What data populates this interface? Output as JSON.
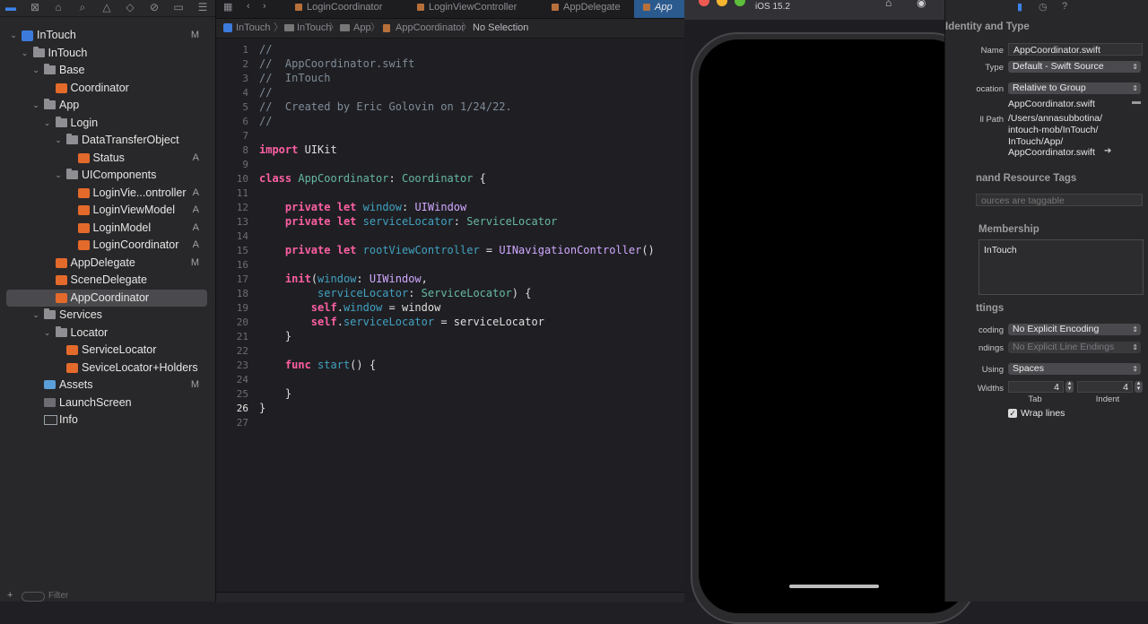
{
  "navigator": {
    "tree": [
      {
        "label": "InTouch",
        "badge": "M",
        "icon": "project-icon",
        "chev": "open"
      },
      {
        "label": "InTouch",
        "badge": "",
        "icon": "folder-icon",
        "chev": "open"
      },
      {
        "label": "Base",
        "badge": "",
        "icon": "folder-icon",
        "chev": "open"
      },
      {
        "label": "Coordinator",
        "badge": "",
        "icon": "swift-file-icon",
        "chev": ""
      },
      {
        "label": "App",
        "badge": "",
        "icon": "folder-icon",
        "chev": "open"
      },
      {
        "label": "Login",
        "badge": "",
        "icon": "folder-icon",
        "chev": "open"
      },
      {
        "label": "DataTransferObject",
        "badge": "",
        "icon": "folder-icon",
        "chev": "open"
      },
      {
        "label": "Status",
        "badge": "A",
        "icon": "swift-file-icon",
        "chev": ""
      },
      {
        "label": "UIComponents",
        "badge": "",
        "icon": "folder-icon",
        "chev": "open"
      },
      {
        "label": "LoginVie...ontroller",
        "badge": "A",
        "icon": "swift-file-icon",
        "chev": ""
      },
      {
        "label": "LoginViewModel",
        "badge": "A",
        "icon": "swift-file-icon",
        "chev": ""
      },
      {
        "label": "LoginModel",
        "badge": "A",
        "icon": "swift-file-icon",
        "chev": ""
      },
      {
        "label": "LoginCoordinator",
        "badge": "A",
        "icon": "swift-file-icon",
        "chev": ""
      },
      {
        "label": "AppDelegate",
        "badge": "M",
        "icon": "swift-file-icon",
        "chev": ""
      },
      {
        "label": "SceneDelegate",
        "badge": "",
        "icon": "swift-file-icon",
        "chev": ""
      },
      {
        "label": "AppCoordinator",
        "badge": "",
        "icon": "swift-file-icon",
        "chev": "",
        "selected": true
      },
      {
        "label": "Services",
        "badge": "",
        "icon": "folder-icon",
        "chev": "open"
      },
      {
        "label": "Locator",
        "badge": "",
        "icon": "folder-icon",
        "chev": "open"
      },
      {
        "label": "ServiceLocator",
        "badge": "",
        "icon": "swift-file-icon",
        "chev": ""
      },
      {
        "label": "SeviceLocator+Holders",
        "badge": "",
        "icon": "swift-file-icon",
        "chev": ""
      },
      {
        "label": "Assets",
        "badge": "M",
        "icon": "asset-catalog-icon",
        "chev": ""
      },
      {
        "label": "LaunchScreen",
        "badge": "",
        "icon": "storyboard-icon",
        "chev": ""
      },
      {
        "label": "Info",
        "badge": "",
        "icon": "plist-icon",
        "chev": ""
      }
    ],
    "filter_placeholder": "Filter"
  },
  "tabs": [
    "LoginCoordinator",
    "LoginViewController",
    "AppDelegate",
    "App"
  ],
  "jumpbar": [
    "InTouch",
    "InTouch",
    "App",
    "AppCoordinator",
    "No Selection"
  ],
  "editor": {
    "current_line": 26,
    "lines": [
      [
        [
          "cmt",
          "//"
        ]
      ],
      [
        [
          "cmt",
          "//  AppCoordinator.swift"
        ]
      ],
      [
        [
          "cmt",
          "//  InTouch"
        ]
      ],
      [
        [
          "cmt",
          "//"
        ]
      ],
      [
        [
          "cmt",
          "//  Created by Eric Golovin on 1/24/22."
        ]
      ],
      [
        [
          "cmt",
          "//"
        ]
      ],
      [],
      [
        [
          "kw",
          "import"
        ],
        [
          "pl",
          " UIKit"
        ]
      ],
      [],
      [
        [
          "kw",
          "class"
        ],
        [
          "pl",
          " "
        ],
        [
          "ident",
          "AppCoordinator"
        ],
        [
          "pl",
          ": "
        ],
        [
          "ident",
          "Coordinator"
        ],
        [
          "pl",
          " {"
        ]
      ],
      [],
      [
        [
          "pl",
          "    "
        ],
        [
          "kw",
          "private"
        ],
        [
          "pl",
          " "
        ],
        [
          "kw",
          "let"
        ],
        [
          "pl",
          " "
        ],
        [
          "prop",
          "window"
        ],
        [
          "pl",
          ": "
        ],
        [
          "typ",
          "UIWindow"
        ]
      ],
      [
        [
          "pl",
          "    "
        ],
        [
          "kw",
          "private"
        ],
        [
          "pl",
          " "
        ],
        [
          "kw",
          "let"
        ],
        [
          "pl",
          " "
        ],
        [
          "prop",
          "serviceLocator"
        ],
        [
          "pl",
          ": "
        ],
        [
          "ident",
          "ServiceLocator"
        ]
      ],
      [],
      [
        [
          "pl",
          "    "
        ],
        [
          "kw",
          "private"
        ],
        [
          "pl",
          " "
        ],
        [
          "kw",
          "let"
        ],
        [
          "pl",
          " "
        ],
        [
          "prop",
          "rootViewController"
        ],
        [
          "pl",
          " = "
        ],
        [
          "typ",
          "UINavigationController"
        ],
        [
          "pl",
          "()"
        ]
      ],
      [],
      [
        [
          "pl",
          "    "
        ],
        [
          "kw",
          "init"
        ],
        [
          "pl",
          "("
        ],
        [
          "prop",
          "window"
        ],
        [
          "pl",
          ": "
        ],
        [
          "typ",
          "UIWindow"
        ],
        [
          "pl",
          ","
        ]
      ],
      [
        [
          "pl",
          "         "
        ],
        [
          "prop",
          "serviceLocator"
        ],
        [
          "pl",
          ": "
        ],
        [
          "ident",
          "ServiceLocator"
        ],
        [
          "pl",
          ") {"
        ]
      ],
      [
        [
          "pl",
          "        "
        ],
        [
          "kw",
          "self"
        ],
        [
          "pl",
          "."
        ],
        [
          "prop",
          "window"
        ],
        [
          "pl",
          " = window"
        ]
      ],
      [
        [
          "pl",
          "        "
        ],
        [
          "kw",
          "self"
        ],
        [
          "pl",
          "."
        ],
        [
          "prop",
          "serviceLocator"
        ],
        [
          "pl",
          " = serviceLocator"
        ]
      ],
      [
        [
          "pl",
          "    }"
        ]
      ],
      [],
      [
        [
          "pl",
          "    "
        ],
        [
          "kw",
          "func"
        ],
        [
          "pl",
          " "
        ],
        [
          "prop",
          "start"
        ],
        [
          "pl",
          "() {"
        ]
      ],
      [],
      [
        [
          "pl",
          "    }"
        ]
      ],
      [
        [
          "pl",
          "}"
        ]
      ],
      []
    ]
  },
  "simulator": {
    "device_title": "iOS 15.2"
  },
  "inspector": {
    "identity_header": "Identity and Type",
    "name_label": "Name",
    "name_value": "AppCoordinator.swift",
    "type_label": "Type",
    "type_value": "Default - Swift Source",
    "location_label": "ocation",
    "location_value": "Relative to Group",
    "location_file": "AppCoordinator.swift",
    "fullpath_label": "ll Path",
    "fullpath_lines": [
      "/Users/annasubbotina/",
      "intouch-mob/InTouch/",
      "InTouch/App/",
      "AppCoordinator.swift"
    ],
    "tags_header": "nand Resource Tags",
    "tags_placeholder": "ources are taggable",
    "membership_header": "Membership",
    "membership_target": "InTouch",
    "settings_header": "ttings",
    "encoding_label": "coding",
    "encoding_value": "No Explicit Encoding",
    "endings_label": "ndings",
    "endings_value": "No Explicit Line Endings",
    "using_label": "Using",
    "using_value": "Spaces",
    "widths_label": "Widths",
    "tab_value": "4",
    "indent_value": "4",
    "tab_caption": "Tab",
    "indent_caption": "Indent",
    "wrap_label": "Wrap lines"
  }
}
